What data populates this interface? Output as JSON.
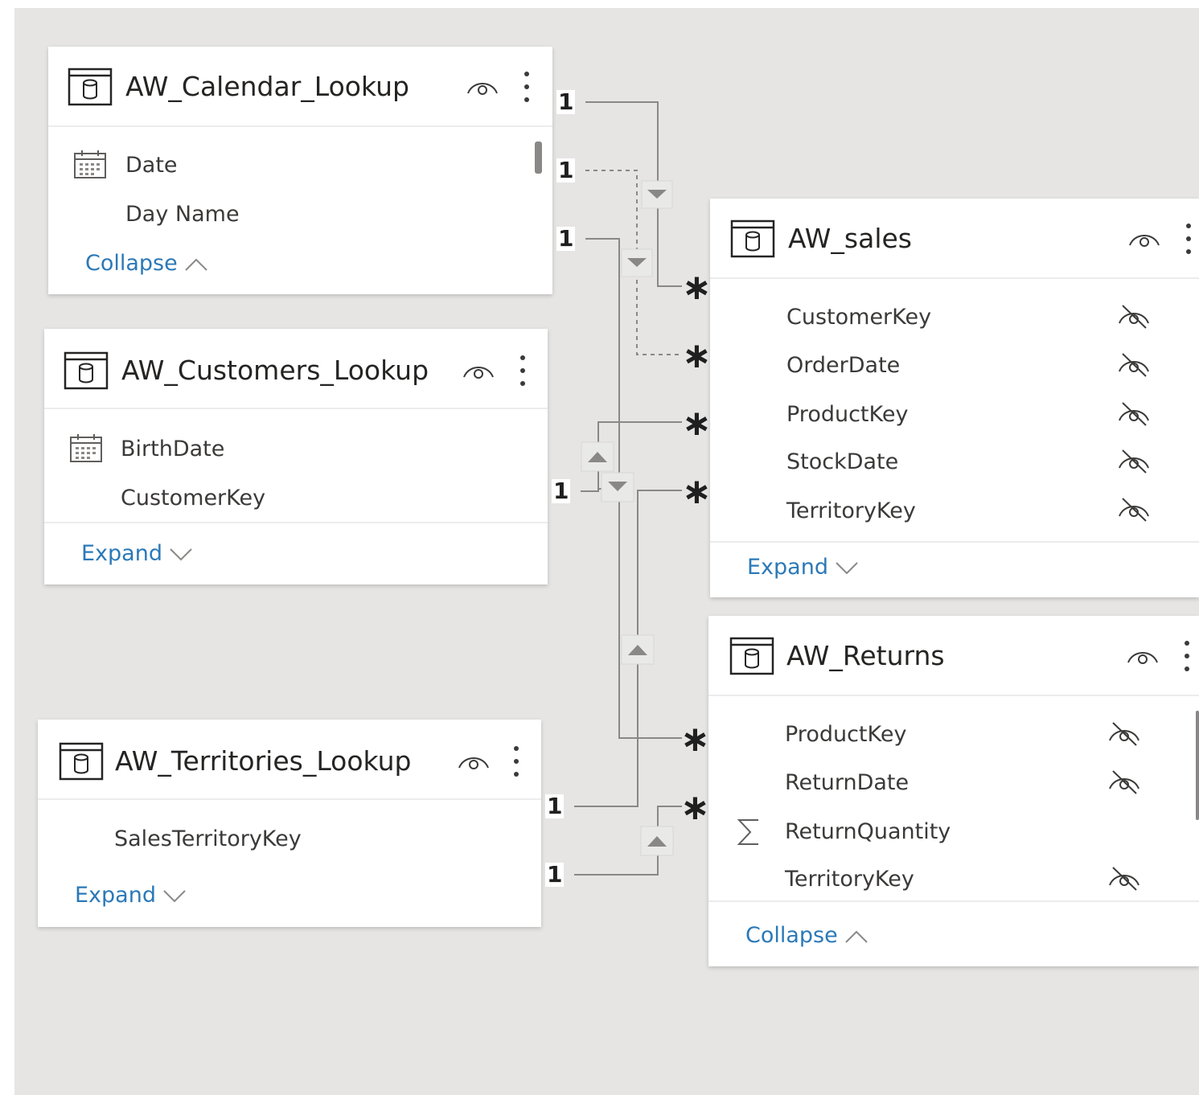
{
  "tables": {
    "calendar": {
      "title": "AW_Calendar_Lookup",
      "fields": [
        {
          "label": "Date",
          "icon": "calendar-icon"
        },
        {
          "label": "Day Name",
          "icon": ""
        }
      ],
      "toggle": "Collapse",
      "toggle_icon": "chevron-up-icon"
    },
    "customers": {
      "title": "AW_Customers_Lookup",
      "fields": [
        {
          "label": "BirthDate",
          "icon": "calendar-icon"
        },
        {
          "label": "CustomerKey",
          "icon": ""
        }
      ],
      "toggle": "Expand",
      "toggle_icon": "chevron-down-icon"
    },
    "territories": {
      "title": "AW_Territories_Lookup",
      "fields": [
        {
          "label": "SalesTerritoryKey",
          "icon": ""
        }
      ],
      "toggle": "Expand",
      "toggle_icon": "chevron-down-icon"
    },
    "sales": {
      "title": "AW_sales",
      "fields": [
        {
          "label": "CustomerKey",
          "hidden": true
        },
        {
          "label": "OrderDate",
          "hidden": true
        },
        {
          "label": "ProductKey",
          "hidden": true
        },
        {
          "label": "StockDate",
          "hidden": true
        },
        {
          "label": "TerritoryKey",
          "hidden": true
        }
      ],
      "toggle": "Expand",
      "toggle_icon": "chevron-down-icon"
    },
    "returns": {
      "title": "AW_Returns",
      "fields": [
        {
          "label": "ProductKey",
          "hidden": true,
          "icon": ""
        },
        {
          "label": "ReturnDate",
          "hidden": true,
          "icon": ""
        },
        {
          "label": "ReturnQuantity",
          "hidden": false,
          "icon": "sigma-icon"
        },
        {
          "label": "TerritoryKey",
          "hidden": true,
          "icon": ""
        }
      ],
      "toggle": "Collapse",
      "toggle_icon": "chevron-up-icon"
    }
  },
  "cardinality": {
    "one": "1",
    "many": "∗"
  },
  "relationships": [
    {
      "from": "AW_Calendar_Lookup",
      "to": "AW_sales",
      "from_card": "1",
      "to_card": "∗",
      "active": true,
      "direction": "single"
    },
    {
      "from": "AW_Calendar_Lookup",
      "to": "AW_sales",
      "from_card": "1",
      "to_card": "∗",
      "active": false,
      "direction": "single"
    },
    {
      "from": "AW_Calendar_Lookup",
      "to": "AW_Returns",
      "from_card": "1",
      "to_card": "∗",
      "active": true,
      "direction": "single"
    },
    {
      "from": "AW_Customers_Lookup",
      "to": "AW_sales",
      "from_card": "1",
      "to_card": "∗",
      "active": true,
      "direction": "single"
    },
    {
      "from": "AW_Territories_Lookup",
      "to": "AW_sales",
      "from_card": "1",
      "to_card": "∗",
      "active": true,
      "direction": "single"
    },
    {
      "from": "AW_Territories_Lookup",
      "to": "AW_Returns",
      "from_card": "1",
      "to_card": "∗",
      "active": true,
      "direction": "single"
    }
  ],
  "colors": {
    "canvas": "#e6e5e4",
    "card": "#ffffff",
    "link": "#2b79b8",
    "line": "#8a8886",
    "text": "#252423"
  }
}
